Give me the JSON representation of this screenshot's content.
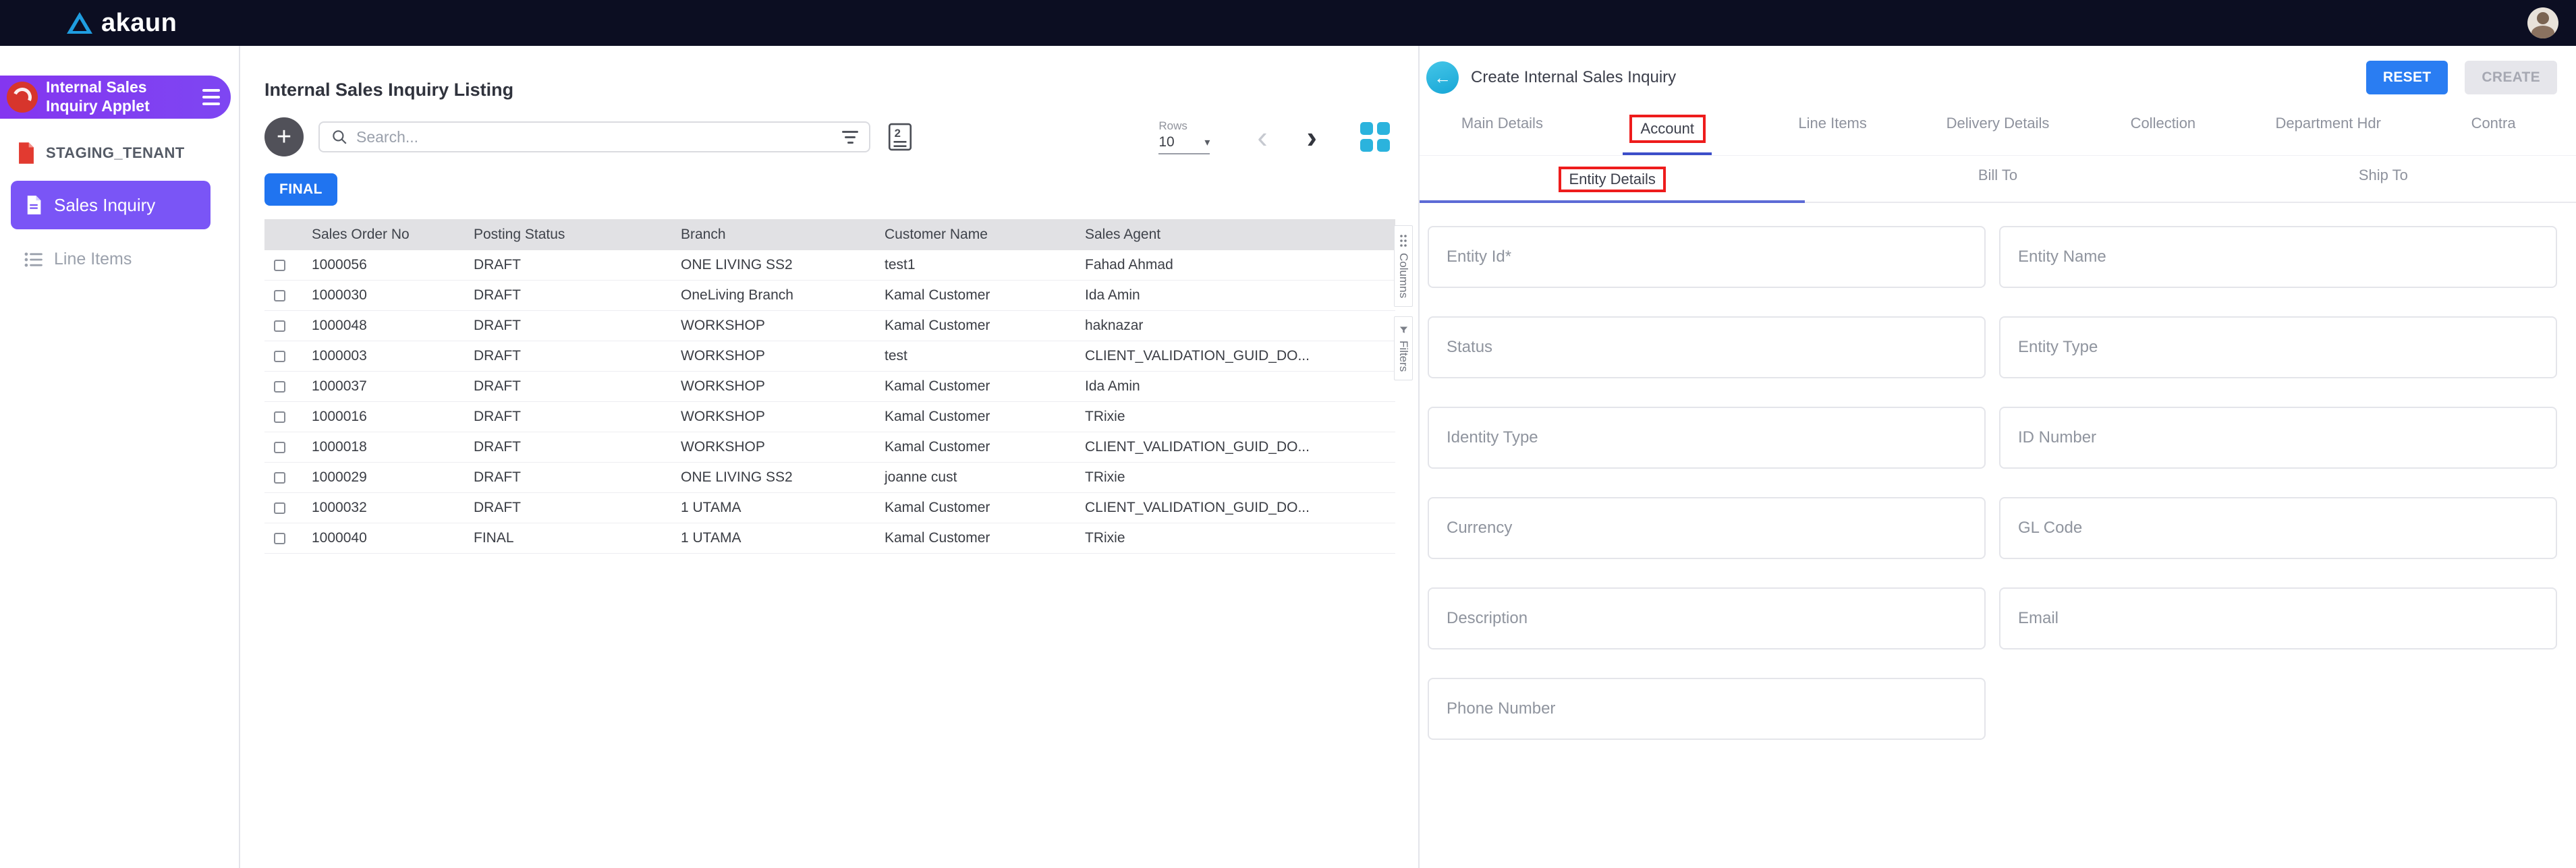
{
  "topbar": {
    "brand": "akaun"
  },
  "sidebar": {
    "applet_label": "Internal Sales Inquiry Applet",
    "tenant_label": "STAGING_TENANT",
    "items": [
      {
        "label": "Sales Inquiry",
        "active": true
      },
      {
        "label": "Line Items",
        "active": false
      }
    ]
  },
  "listing": {
    "title": "Internal Sales Inquiry Listing",
    "search_placeholder": "Search...",
    "rows_label": "Rows",
    "rows_value": "10",
    "status_filter_label": "FINAL",
    "table": {
      "columns": [
        "Sales Order No",
        "Posting Status",
        "Branch",
        "Customer Name",
        "Sales Agent"
      ],
      "rows": [
        [
          "1000056",
          "DRAFT",
          "ONE LIVING SS2",
          "test1",
          "Fahad Ahmad"
        ],
        [
          "1000030",
          "DRAFT",
          "OneLiving Branch",
          "Kamal Customer",
          "Ida Amin"
        ],
        [
          "1000048",
          "DRAFT",
          "WORKSHOP",
          "Kamal Customer",
          "haknazar"
        ],
        [
          "1000003",
          "DRAFT",
          "WORKSHOP",
          "test",
          "CLIENT_VALIDATION_GUID_DO..."
        ],
        [
          "1000037",
          "DRAFT",
          "WORKSHOP",
          "Kamal Customer",
          "Ida Amin"
        ],
        [
          "1000016",
          "DRAFT",
          "WORKSHOP",
          "Kamal Customer",
          "TRixie"
        ],
        [
          "1000018",
          "DRAFT",
          "WORKSHOP",
          "Kamal Customer",
          "CLIENT_VALIDATION_GUID_DO..."
        ],
        [
          "1000029",
          "DRAFT",
          "ONE LIVING SS2",
          "joanne cust",
          "TRixie"
        ],
        [
          "1000032",
          "DRAFT",
          "1 UTAMA",
          "Kamal Customer",
          "CLIENT_VALIDATION_GUID_DO..."
        ],
        [
          "1000040",
          "FINAL",
          "1 UTAMA",
          "Kamal Customer",
          "TRixie"
        ]
      ]
    },
    "side_tabs": {
      "columns": "Columns",
      "filters": "Filters"
    }
  },
  "create_panel": {
    "title": "Create Internal Sales Inquiry",
    "reset_label": "RESET",
    "create_label": "CREATE",
    "tabs": [
      "Main Details",
      "Account",
      "Line Items",
      "Delivery Details",
      "Collection",
      "Department Hdr",
      "Contra"
    ],
    "active_tab": "Account",
    "subtabs": [
      "Entity Details",
      "Bill To",
      "Ship To"
    ],
    "active_subtab": "Entity Details",
    "fields": [
      "Entity Id*",
      "Entity Name",
      "Status",
      "Entity Type",
      "Identity Type",
      "ID Number",
      "Currency",
      "GL Code",
      "Description",
      "Email",
      "Phone Number"
    ]
  },
  "glyphs": {
    "plus": "+",
    "back": "←",
    "prev": "‹",
    "next": "›",
    "caret": "▾",
    "preset_count": "2"
  },
  "colors": {
    "topbar": "#0c0e22",
    "sidebar_applet": "#8436f0",
    "sidebar_item_active": "#7a55f6",
    "primary_blue": "#2a7df2",
    "final_button": "#2074f0",
    "teal": "#2bb3dd",
    "annotation_red": "#ee1c1c",
    "tab_indicator": "#3c4ec9",
    "subtab_indicator": "#5d6bd6"
  }
}
